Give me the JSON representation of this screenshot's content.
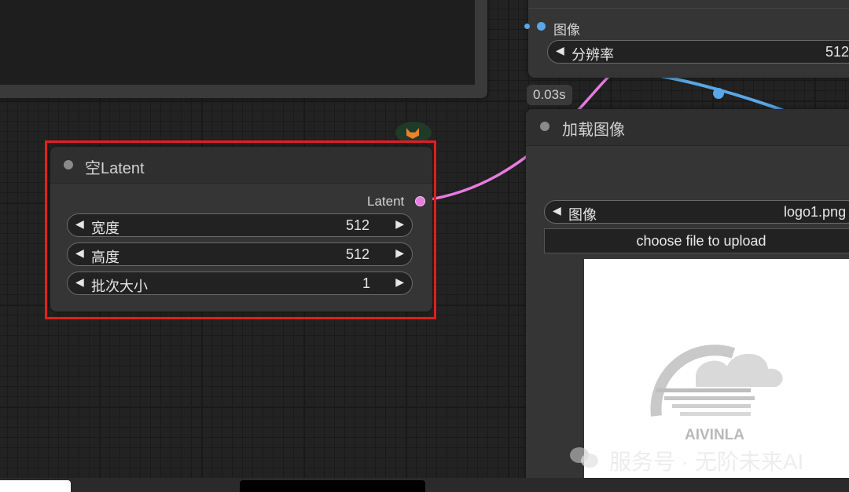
{
  "load_image_node": {
    "title": "加载图像",
    "image_widget": {
      "label": "图像",
      "value": "logo1.png"
    },
    "upload_button": "choose file to upload",
    "preview": {
      "brand_text": "AIVINLA"
    }
  },
  "top_right_node": {
    "output_label": "图像",
    "resolution_widget": {
      "label": "分辨率",
      "value": "512"
    }
  },
  "timing_badge": "0.03s",
  "empty_latent_node": {
    "title": "空Latent",
    "output_label": "Latent",
    "widgets": [
      {
        "label": "宽度",
        "value": "512"
      },
      {
        "label": "高度",
        "value": "512"
      },
      {
        "label": "批次大小",
        "value": "1"
      }
    ]
  },
  "watermark": "服务号 · 无阶未来AI",
  "icons": {
    "arrow_left": "◀",
    "arrow_right": "▶",
    "status_node": "fox-icon",
    "wechat": "wechat-icon"
  },
  "colors": {
    "latent_wire": "#e87be0",
    "image_wire": "#5aa6e6",
    "highlight": "#e02020"
  }
}
